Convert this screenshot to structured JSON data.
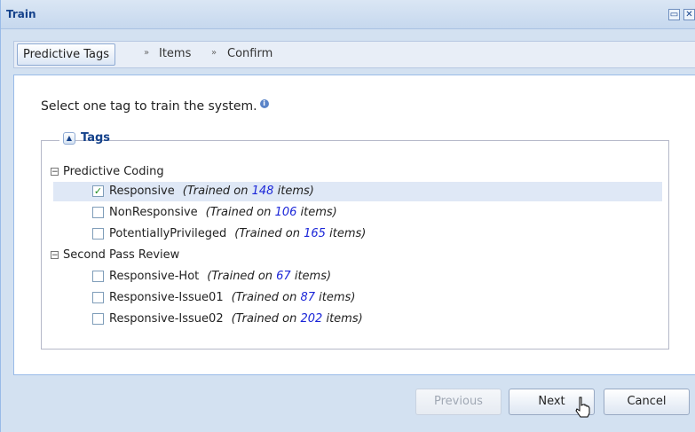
{
  "window": {
    "title": "Train"
  },
  "wizard": {
    "steps": [
      "Predictive Tags",
      "Items",
      "Confirm"
    ],
    "separator": "»"
  },
  "main": {
    "instruction": "Select one tag to train the system.",
    "fieldset_label": "Tags",
    "groups": [
      {
        "label": "Predictive Coding",
        "items": [
          {
            "name": "Responsive",
            "prefix": "(Trained on",
            "count": "148",
            "suffix": "items)",
            "checked": true
          },
          {
            "name": "NonResponsive",
            "prefix": "(Trained on",
            "count": "106",
            "suffix": "items)",
            "checked": false
          },
          {
            "name": "PotentiallyPrivileged",
            "prefix": "(Trained on",
            "count": "165",
            "suffix": "items)",
            "checked": false
          }
        ]
      },
      {
        "label": "Second Pass Review",
        "items": [
          {
            "name": "Responsive-Hot",
            "prefix": "(Trained on",
            "count": "67",
            "suffix": "items)",
            "checked": false
          },
          {
            "name": "Responsive-Issue01",
            "prefix": "(Trained on",
            "count": "87",
            "suffix": "items)",
            "checked": false
          },
          {
            "name": "Responsive-Issue02",
            "prefix": "(Trained on",
            "count": "202",
            "suffix": "items)",
            "checked": false
          }
        ]
      }
    ]
  },
  "footer": {
    "previous": "Previous",
    "next": "Next",
    "cancel": "Cancel"
  },
  "colors": {
    "accent": "#15428b",
    "count": "#1b26d8",
    "selected_row": "#dfe8f6"
  }
}
